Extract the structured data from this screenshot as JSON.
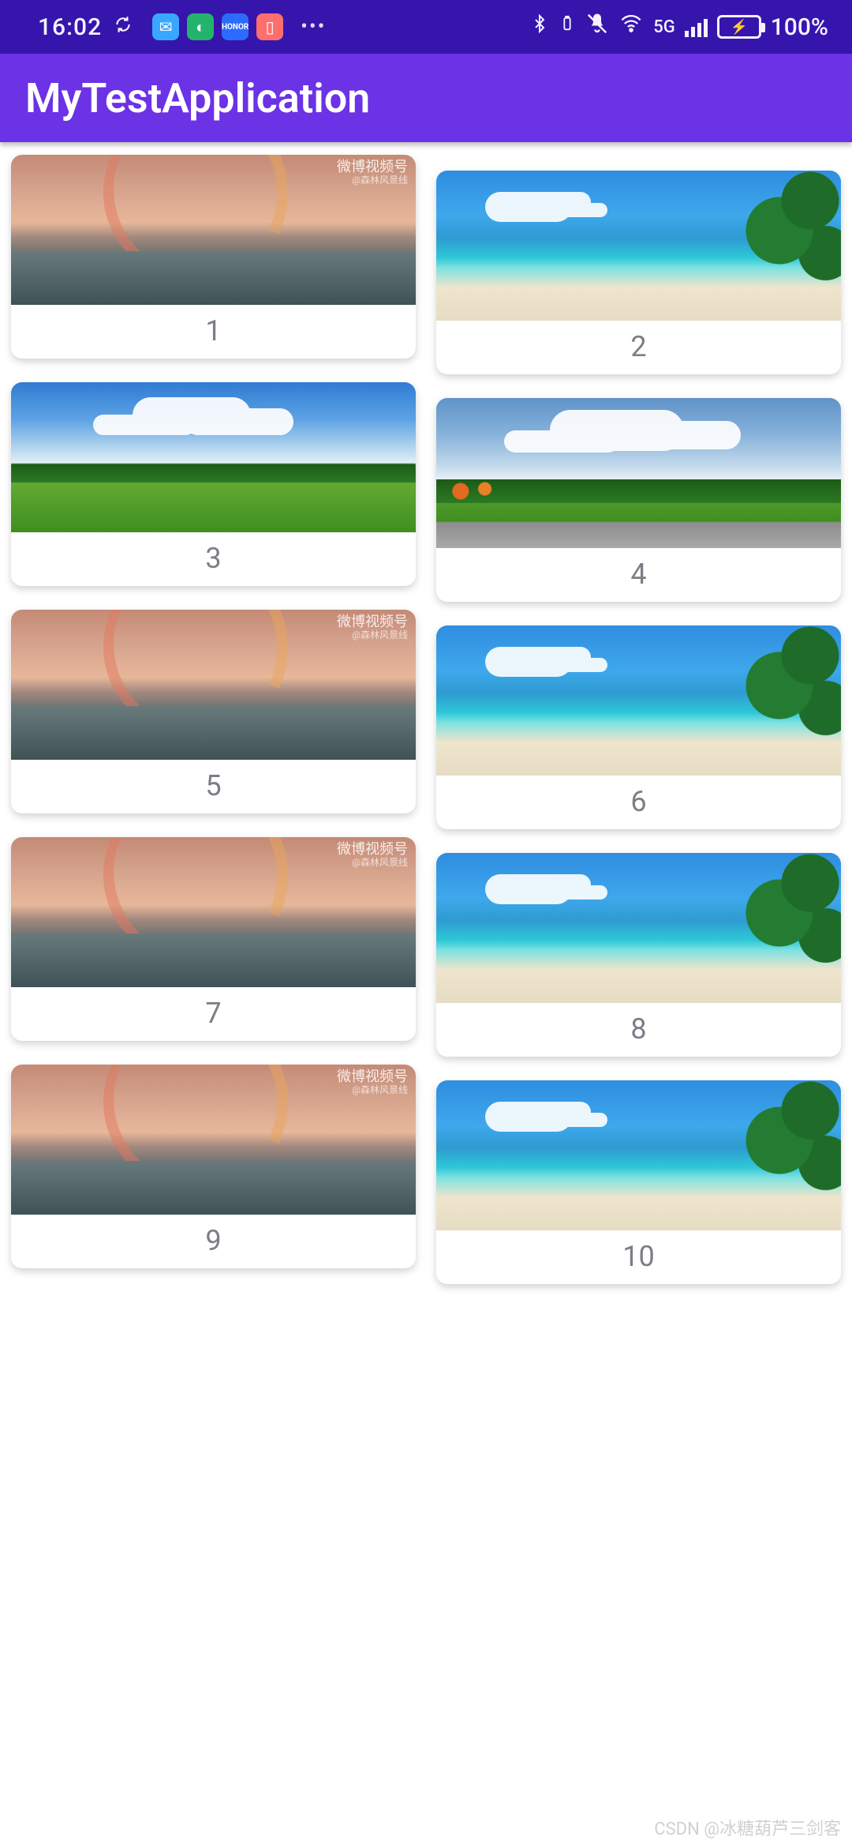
{
  "status": {
    "time": "16:02",
    "network_label": "5G",
    "battery_percent": "100%",
    "left_icons": [
      "loop-icon",
      "messenger-icon",
      "chat-icon",
      "honor-icon",
      "book-icon"
    ],
    "right_icons": [
      "bluetooth-icon",
      "battery-small-icon",
      "mute-icon",
      "wifi-icon",
      "signal-icon",
      "battery-icon"
    ]
  },
  "appbar": {
    "title": "MyTestApplication"
  },
  "cards_left": [
    {
      "label": "1",
      "image_type": "rainbow",
      "watermark": "微博视频号",
      "watermark_sub": "@森林风景线"
    },
    {
      "label": "3",
      "image_type": "lawn"
    },
    {
      "label": "5",
      "image_type": "rainbow",
      "watermark": "微博视频号",
      "watermark_sub": "@森林风景线"
    },
    {
      "label": "7",
      "image_type": "rainbow",
      "watermark": "微博视频号",
      "watermark_sub": "@森林风景线"
    },
    {
      "label": "9",
      "image_type": "rainbow",
      "watermark": "微博视频号",
      "watermark_sub": "@森林风景线"
    }
  ],
  "cards_right": [
    {
      "label": "2",
      "image_type": "beach"
    },
    {
      "label": "4",
      "image_type": "park"
    },
    {
      "label": "6",
      "image_type": "beach"
    },
    {
      "label": "8",
      "image_type": "beach"
    },
    {
      "label": "10",
      "image_type": "beach"
    }
  ],
  "footer_watermark": "CSDN @冰糖葫芦三剑客"
}
